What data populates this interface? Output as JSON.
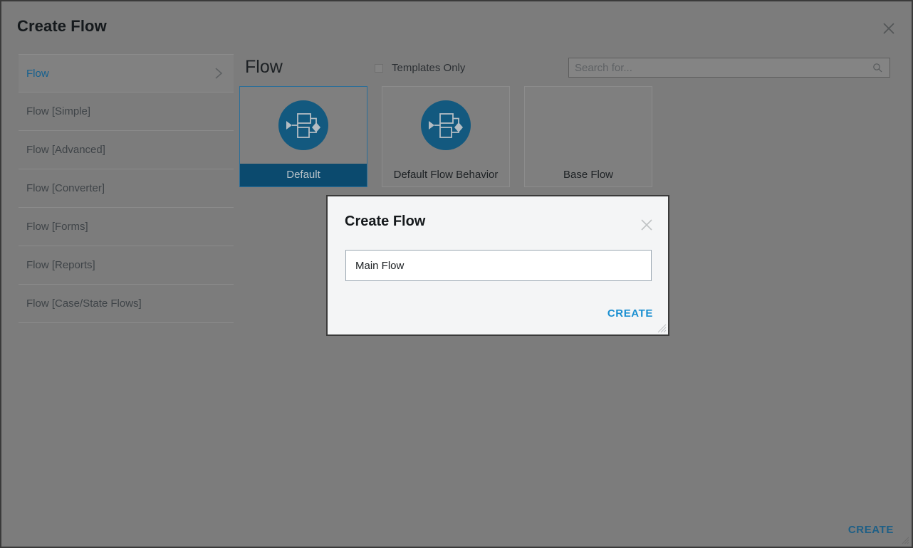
{
  "window": {
    "title": "Create Flow",
    "close_icon": "close-icon",
    "resize_grip_icon": "resize-grip-icon",
    "footer_create_label": "CREATE"
  },
  "sidebar": {
    "items": [
      {
        "label": "Flow",
        "selected": true,
        "chevron_icon": "chevron-right-icon"
      },
      {
        "label": "Flow [Simple]",
        "selected": false
      },
      {
        "label": "Flow [Advanced]",
        "selected": false
      },
      {
        "label": "Flow [Converter]",
        "selected": false
      },
      {
        "label": "Flow [Forms]",
        "selected": false
      },
      {
        "label": "Flow [Reports]",
        "selected": false
      },
      {
        "label": "Flow [Case/State Flows]",
        "selected": false
      }
    ]
  },
  "main": {
    "title": "Flow",
    "templates_only": {
      "label": "Templates Only",
      "checked": false
    },
    "search": {
      "placeholder": "Search for...",
      "value": "",
      "icon": "search-icon"
    },
    "cards": [
      {
        "label": "Default",
        "selected": true,
        "icon": "flow-diagram-icon"
      },
      {
        "label": "Default Flow Behavior",
        "selected": false,
        "icon": "flow-diagram-icon"
      },
      {
        "label": "Base Flow",
        "selected": false,
        "icon": "none"
      }
    ]
  },
  "modal": {
    "title": "Create Flow",
    "close_icon": "close-icon",
    "name_input": {
      "value": "Main Flow",
      "placeholder": ""
    },
    "create_label": "CREATE",
    "resize_grip_icon": "resize-grip-icon"
  },
  "colors": {
    "backdrop": "#7c7c7c",
    "accent_blue": "#0b4a6e",
    "link_blue": "#1a8fd1",
    "footer_link_blue": "#1e5f86",
    "icon_blue": "#13597f",
    "modal_bg": "#f4f5f6"
  }
}
